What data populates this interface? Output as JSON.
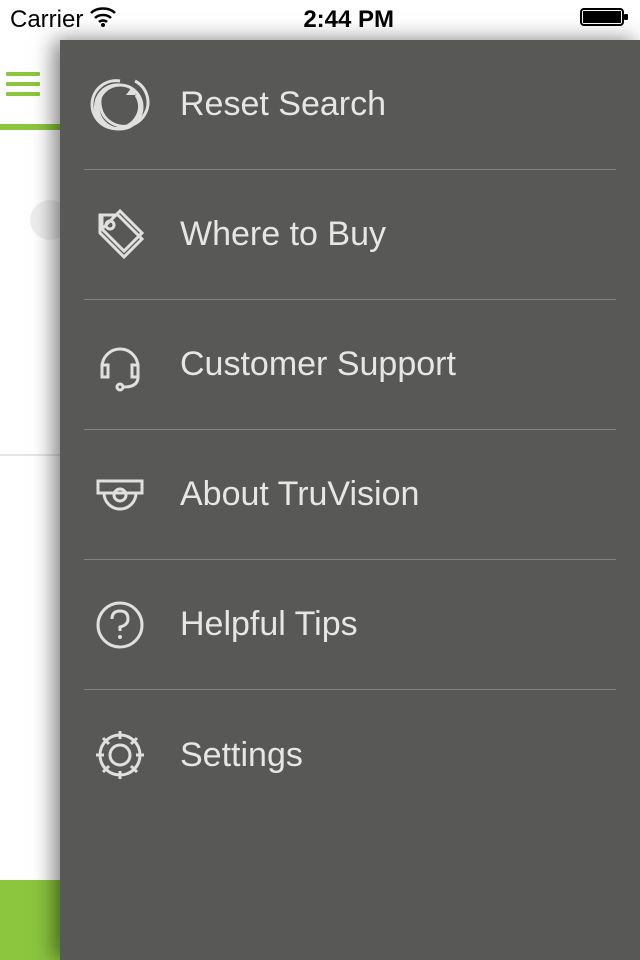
{
  "status_bar": {
    "carrier": "Carrier",
    "time": "2:44 PM"
  },
  "menu": {
    "items": [
      {
        "label": "Reset Search",
        "icon": "reset-icon"
      },
      {
        "label": "Where to Buy",
        "icon": "tag-icon"
      },
      {
        "label": "Customer Support",
        "icon": "headset-icon"
      },
      {
        "label": "About TruVision",
        "icon": "camera-dome-icon"
      },
      {
        "label": "Helpful Tips",
        "icon": "help-icon"
      },
      {
        "label": "Settings",
        "icon": "gear-icon"
      }
    ]
  },
  "colors": {
    "accent": "#8cc63f",
    "drawer_bg": "#585856"
  }
}
